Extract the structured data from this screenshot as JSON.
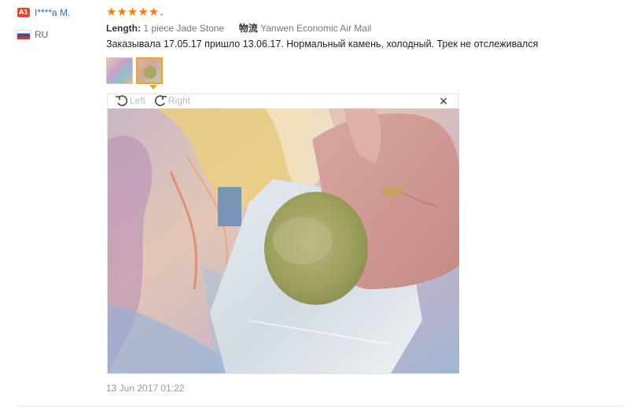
{
  "reviewer": {
    "level_badge": "A1",
    "name": "I****a M.",
    "country_code": "RU"
  },
  "review": {
    "rating": 5,
    "star_glyph": "★",
    "attributes": [
      {
        "key": "Length:",
        "value": "1 piece Jade Stone"
      },
      {
        "key": "物流",
        "value": "Yanwen Economic Air Mail"
      }
    ],
    "text": "Заказывала 17.05.17 пришло 13.06.17. Нормальный камень, холодный. Трек не отслеживался",
    "date": "13 Jun 2017 01:22",
    "photo_count": 2,
    "active_photo_index": 1
  },
  "viewer": {
    "rotate_left_label": "Left",
    "rotate_right_label": "Right",
    "close_glyph": "×"
  },
  "colors": {
    "accent": "#ff7a00",
    "link": "#2a6ebb",
    "badge": "#e8482a",
    "active_thumb_border": "#f7a21b"
  }
}
